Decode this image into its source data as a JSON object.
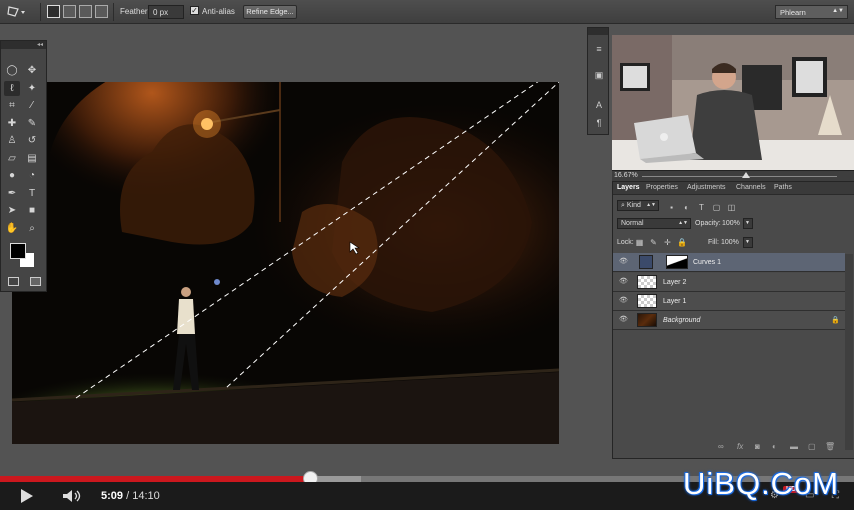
{
  "options_bar": {
    "tool_icon": "polygonal-lasso-icon",
    "feather_label": "Feather:",
    "feather_value": "0 px",
    "antialias_label": "Anti-alias",
    "antialias_checked": true,
    "refine_edge_label": "Refine Edge...",
    "workspace_value": "Phlearn"
  },
  "toolbox": {
    "tools": [
      "marquee-icon",
      "move-icon",
      "lasso-icon",
      "magic-wand-icon",
      "crop-icon",
      "eyedropper-icon",
      "healing-brush-icon",
      "brush-icon",
      "clone-stamp-icon",
      "history-brush-icon",
      "eraser-icon",
      "gradient-icon",
      "blur-icon",
      "dodge-icon",
      "pen-icon",
      "type-icon",
      "path-selection-icon",
      "rectangle-icon",
      "hand-icon",
      "zoom-icon"
    ],
    "foreground_color": "#000000",
    "background_color": "#ffffff"
  },
  "video_panel": {
    "zoom_label": "16.67%"
  },
  "layers_panel": {
    "tabs": [
      "Layers",
      "Properties",
      "Adjustments",
      "Channels",
      "Paths"
    ],
    "active_tab": "Layers",
    "filter_kind": "Kind",
    "blend_mode": "Normal",
    "opacity_label": "Opacity:",
    "opacity_value": "100%",
    "lock_label": "Lock:",
    "fill_label": "Fill:",
    "fill_value": "100%",
    "layers": [
      {
        "name": "Curves 1",
        "selected": true,
        "type": "adjustment"
      },
      {
        "name": "Layer 2",
        "selected": false,
        "type": "transparent"
      },
      {
        "name": "Layer 1",
        "selected": false,
        "type": "transparent"
      },
      {
        "name": "Background",
        "selected": false,
        "type": "background",
        "locked": true
      }
    ]
  },
  "player": {
    "current_time": "5:09",
    "duration": "14:10",
    "time_separator": "/",
    "played_fraction": 0.363,
    "hd_badge": "HD",
    "accent": "#cc181e"
  },
  "watermark": "UiBQ.CoM"
}
